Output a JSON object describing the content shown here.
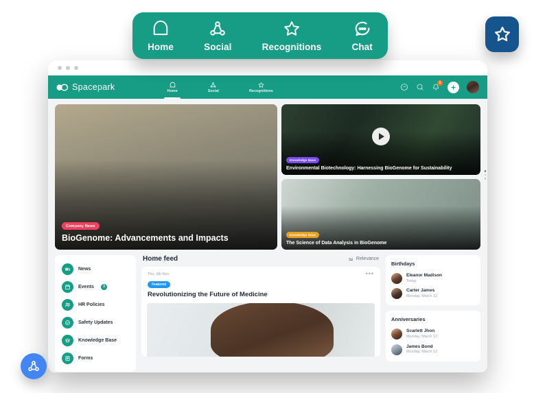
{
  "float_nav": {
    "items": [
      {
        "icon": "home-icon",
        "label": "Home"
      },
      {
        "icon": "social-network-icon",
        "label": "Social"
      },
      {
        "icon": "star-icon",
        "label": "Recognitions"
      },
      {
        "icon": "chat-bubble-icon",
        "label": "Chat"
      }
    ]
  },
  "floating_badges": {
    "star": {
      "icon": "star-icon",
      "color": "#15548c"
    },
    "social": {
      "icon": "social-network-icon",
      "color": "#4285f4"
    }
  },
  "app": {
    "brand": "Spacepark",
    "accent": "#179c86",
    "tabs": [
      {
        "icon": "home-icon",
        "label": "Home",
        "active": true
      },
      {
        "icon": "social-network-icon",
        "label": "Social",
        "active": false
      },
      {
        "icon": "star-icon",
        "label": "Recognitions",
        "active": false
      }
    ],
    "right_icons": [
      {
        "name": "help-circle-icon"
      },
      {
        "name": "search-icon"
      },
      {
        "name": "bell-icon",
        "badge": "1",
        "badge_color": "#f4741f"
      }
    ],
    "add_button": "+",
    "avatar": "user-avatar"
  },
  "hero": {
    "main": {
      "badge": "Company News",
      "badge_color": "#f2415f",
      "title": "BioGenome: Advancements and Impacts"
    },
    "side": [
      {
        "badge": "Knowledge Base",
        "badge_color": "#7b4df0",
        "title": "Environmental Biotechnology: Harnessing BioGenome for Sustainability",
        "has_video": true
      },
      {
        "badge": "Knowledge Base",
        "badge_color": "#e8a020",
        "title": "The Science of Data Analysis in BioGenome",
        "has_video": false
      }
    ]
  },
  "sidebar": {
    "items": [
      {
        "icon": "news-icon",
        "label": "News"
      },
      {
        "icon": "calendar-icon",
        "label": "Events",
        "count": "3"
      },
      {
        "icon": "people-icon",
        "label": "HR Policies"
      },
      {
        "icon": "shield-check-icon",
        "label": "Safety Updates"
      },
      {
        "icon": "graduation-cap-icon",
        "label": "Knowledge Base"
      },
      {
        "icon": "form-document-icon",
        "label": "Forms"
      }
    ]
  },
  "feed": {
    "title": "Home feed",
    "sort_icon": "sort-icon",
    "sort_label": "Relevance",
    "post": {
      "date": "Thu, 9th Nov",
      "badge": "Featured",
      "badge_color": "#2196f3",
      "title": "Revolutionizing the Future of Medicine",
      "more_icon": "more-horizontal-icon"
    }
  },
  "panels": [
    {
      "title": "Birthdays",
      "people": [
        {
          "name": "Eleanor Madison",
          "sub": "Today",
          "avatar": "a"
        },
        {
          "name": "Carter James",
          "sub": "Monday, March 12",
          "avatar": "b"
        }
      ]
    },
    {
      "title": "Anniversaries",
      "people": [
        {
          "name": "Scarlett Jhon",
          "sub": "Monday, March 12",
          "avatar": "c"
        },
        {
          "name": "James Bond",
          "sub": "Monday, March 12",
          "avatar": "d"
        }
      ]
    }
  ]
}
